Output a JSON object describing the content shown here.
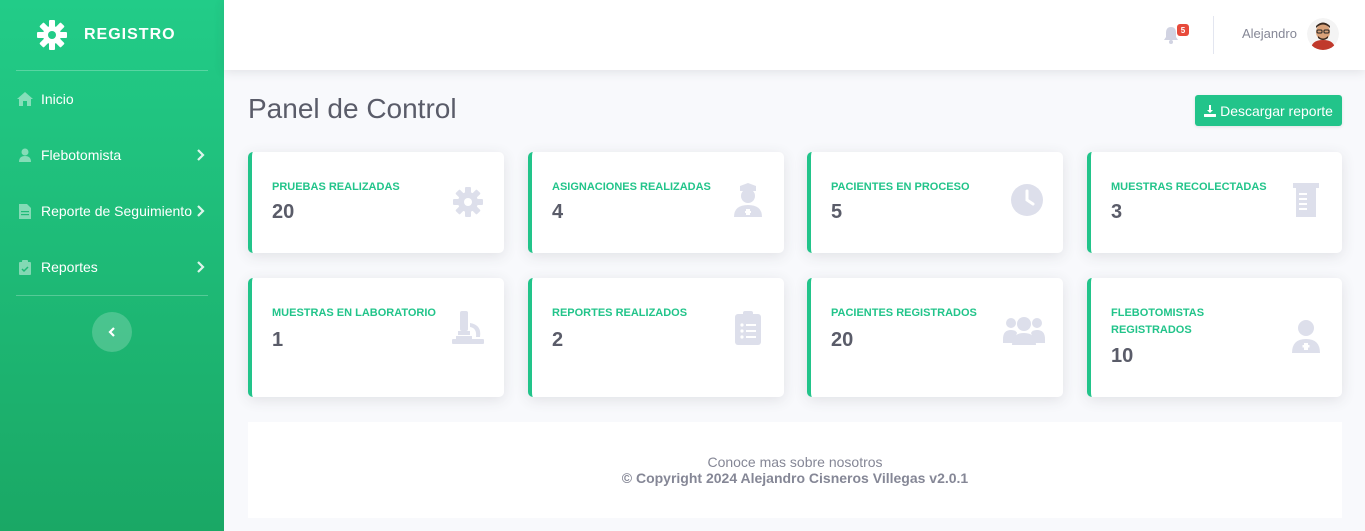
{
  "brand": {
    "name": "REGISTRO",
    "icon": "gear-icon"
  },
  "sidebar": {
    "items": [
      {
        "label": "Inicio",
        "icon": "home-icon",
        "has_chevron": false
      },
      {
        "label": "Flebotomista",
        "icon": "user-icon",
        "has_chevron": true
      },
      {
        "label": "Reporte de Seguimiento",
        "icon": "document-icon",
        "has_chevron": true
      },
      {
        "label": "Reportes",
        "icon": "clipboard-check-icon",
        "has_chevron": true
      }
    ],
    "toggle_icon": "chevron-left-icon"
  },
  "topbar": {
    "notification_count": "5",
    "username": "Alejandro"
  },
  "main": {
    "title": "Panel de Control",
    "report_button": "Descargar reporte"
  },
  "cards": [
    {
      "label": "PRUEBAS REALIZADAS",
      "value": "20",
      "icon": "gear-icon"
    },
    {
      "label": "ASIGNACIONES REALIZADAS",
      "value": "4",
      "icon": "user-nurse-icon"
    },
    {
      "label": "PACIENTES EN PROCESO",
      "value": "5",
      "icon": "clock-icon"
    },
    {
      "label": "MUESTRAS RECOLECTADAS",
      "value": "3",
      "icon": "receipt-icon"
    },
    {
      "label": "MUESTRAS EN LABORATORIO",
      "value": "1",
      "icon": "microscope-icon"
    },
    {
      "label": "REPORTES REALIZADOS",
      "value": "2",
      "icon": "clipboard-list-icon"
    },
    {
      "label": "PACIENTES REGISTRADOS",
      "value": "20",
      "icon": "users-icon"
    },
    {
      "label": "FLEBOTOMISTAS REGISTRADOS",
      "value": "10",
      "icon": "user-doctor-icon"
    }
  ],
  "footer": {
    "line1": "Conoce mas sobre nosotros",
    "line2": "© Copyright 2024 Alejandro Cisneros Villegas v2.0.1"
  },
  "colors": {
    "primary": "#22c48a",
    "sidebar_top": "#22cc88",
    "sidebar_bottom": "#1aa865",
    "icon_gray": "#dddfeb",
    "text": "#5a5c69",
    "badge": "#e74a3b"
  }
}
